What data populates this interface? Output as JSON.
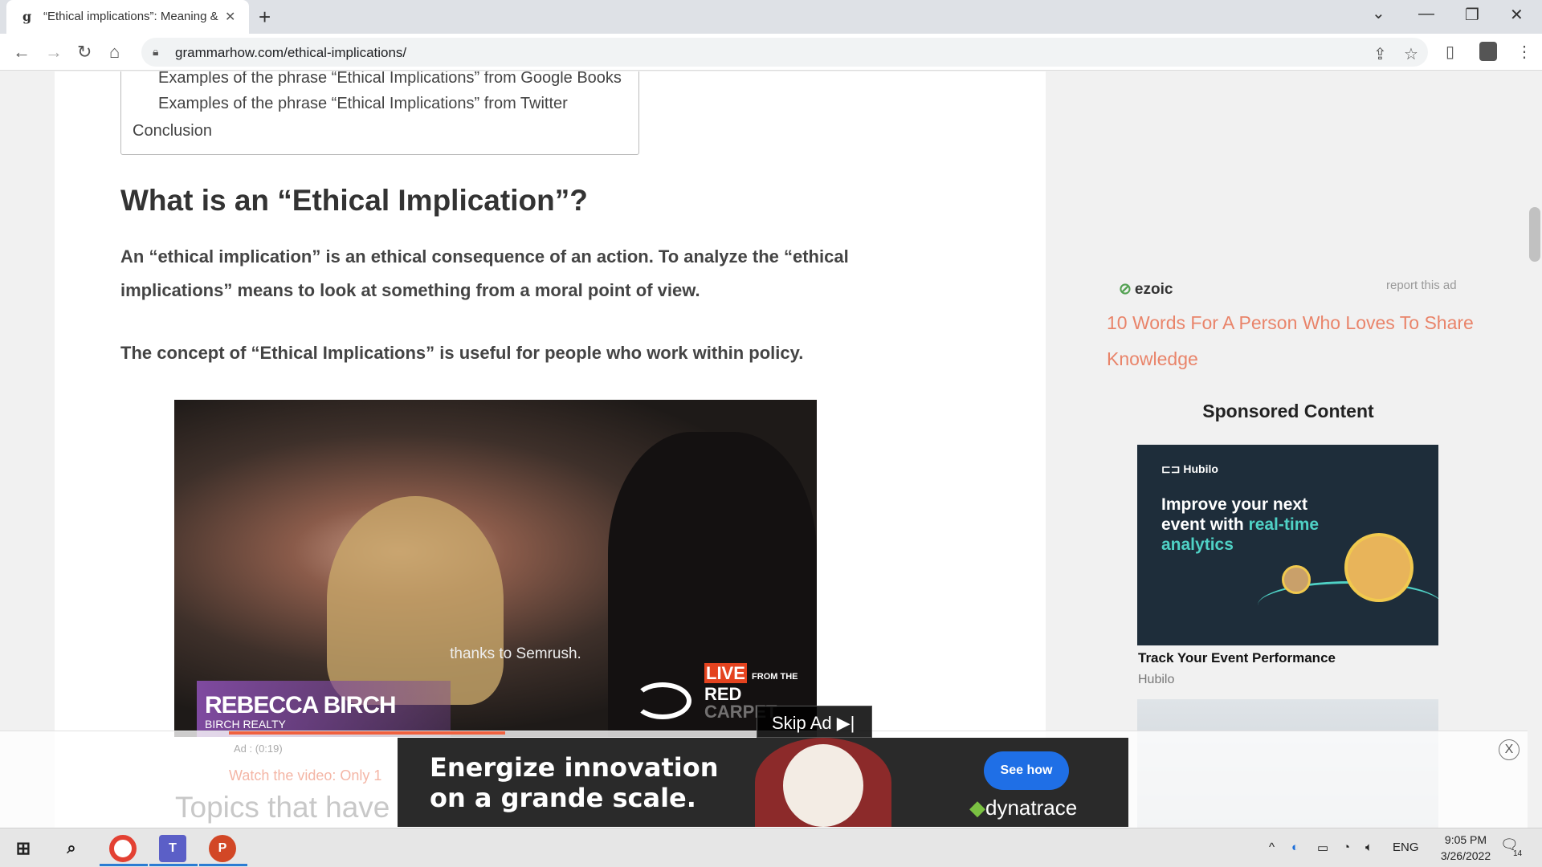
{
  "browser": {
    "tab_favicon": "g",
    "tab_title": "“Ethical implications”: Meaning &",
    "tab_close": "✕",
    "new_tab": "+",
    "url": "grammarhow.com/ethical-implications/"
  },
  "toc": {
    "items": [
      "Examples of the phrase “Ethical Implications” from Google Books",
      "Examples of the phrase “Ethical Implications” from Twitter",
      "Conclusion"
    ]
  },
  "article": {
    "heading": "What is an “Ethical Implication”?",
    "para1_line1": "An “ethical implication” is an ethical consequence of an action. To analyze the “ethical",
    "para1_line2": "implications” means to look at something from a moral point of view.",
    "para2": "The concept of “Ethical Implications” is useful for people who work within policy."
  },
  "video_ad": {
    "subtitle": "thanks to Semrush.",
    "name": "REBECCA BIRCH",
    "company": "BIRCH REALTY",
    "brand_line1": "LIVE",
    "brand_line1_small": "FROM THE",
    "brand_line2": "RED",
    "brand_line3": "CARPET",
    "skip_label": "Skip Ad ▶|",
    "ad_timer": "Ad : (0:19)",
    "watch_text": "Watch the video: Only 1",
    "progress_fraction": 0.43
  },
  "sidebar": {
    "ezoic_logo": "ezoic",
    "report_ad": "report this ad",
    "related_link": "10 Words For A Person Who Loves To Share Knowledge",
    "sponsored_heading": "Sponsored Content",
    "ad1": {
      "logo": "Hubilo",
      "headline_plain": "Improve your next event with ",
      "headline_highlight": "real-time analytics",
      "title": "Track Your Event Performance",
      "source": "Hubilo"
    }
  },
  "anchor_ad": {
    "headline_line1": "Energize innovation",
    "headline_line2": "on a grande scale.",
    "cta": "See how",
    "brand": "dynatrace",
    "close": "X"
  },
  "topics_heading_partial": "Topics that have",
  "taskbar": {
    "language": "ENG",
    "time": "9:05 PM",
    "date": "3/26/2022",
    "notification_count": "14"
  },
  "colors": {
    "link": "#e9846a",
    "accent_orange": "#e4431f",
    "hubilo_teal": "#4fd1c5",
    "cta_blue": "#1f6fe6"
  }
}
